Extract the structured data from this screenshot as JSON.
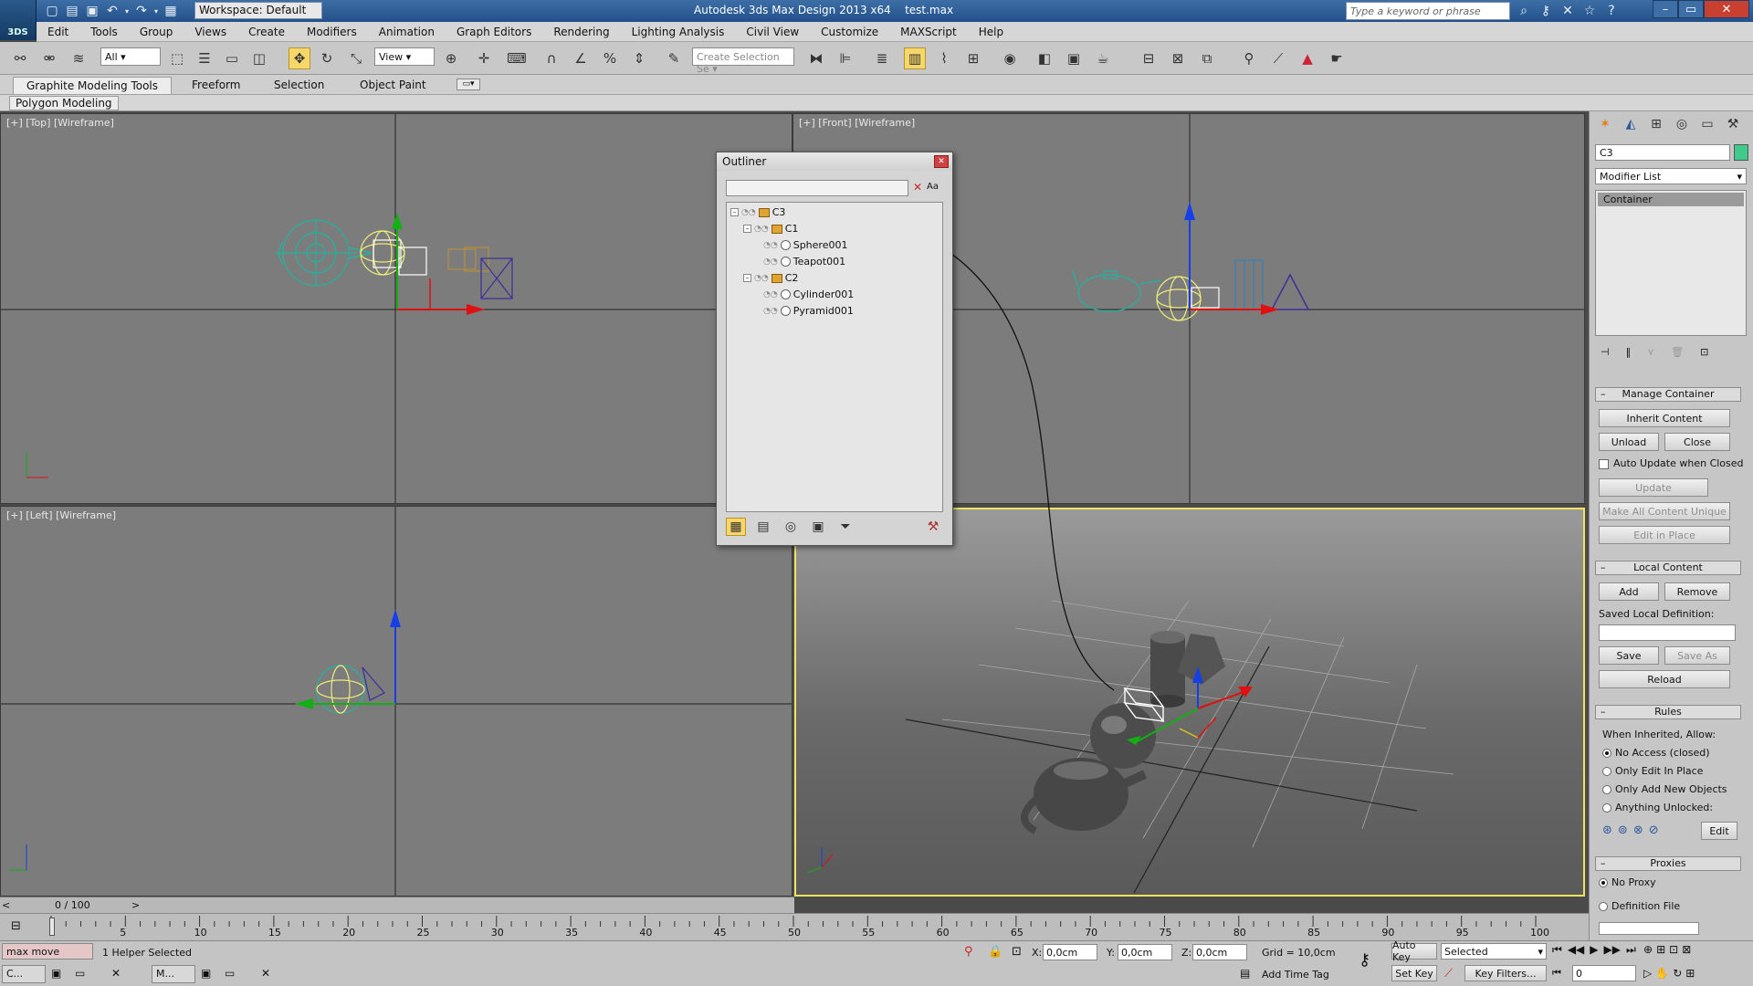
{
  "titlebar": {
    "workspace": "Workspace: Default",
    "app_title": "Autodesk 3ds Max Design 2013 x64",
    "file_name": "test.max",
    "search_placeholder": "Type a keyword or phrase",
    "logo_text": "3DS"
  },
  "menu": [
    "Edit",
    "Tools",
    "Group",
    "Views",
    "Create",
    "Modifiers",
    "Animation",
    "Graph Editors",
    "Rendering",
    "Lighting Analysis",
    "Civil View",
    "Customize",
    "MAXScript",
    "Help"
  ],
  "toolbar": {
    "filter_value": "All",
    "refcoord_value": "View",
    "selection_set_placeholder": "Create Selection Se"
  },
  "ribbon": {
    "tabs": [
      "Graphite Modeling Tools",
      "Freeform",
      "Selection",
      "Object Paint"
    ],
    "panel_label": "Polygon Modeling"
  },
  "viewports": {
    "top": "[+] [Top] [Wireframe]",
    "front": "[+] [Front] [Wireframe]",
    "left": "[+] [Left] [Wireframe]"
  },
  "outliner": {
    "title": "Outliner",
    "search_clear": "✕",
    "case_toggle": "Aa",
    "nodes": [
      {
        "label": "C3",
        "level": 0,
        "type": "container"
      },
      {
        "label": "C1",
        "level": 1,
        "type": "container"
      },
      {
        "label": "Sphere001",
        "level": 2,
        "type": "geo"
      },
      {
        "label": "Teapot001",
        "level": 2,
        "type": "geo"
      },
      {
        "label": "C2",
        "level": 1,
        "type": "container"
      },
      {
        "label": "Cylinder001",
        "level": 2,
        "type": "geo"
      },
      {
        "label": "Pyramid001",
        "level": 2,
        "type": "geo"
      }
    ]
  },
  "command_panel": {
    "object_name": "C3",
    "object_color": "#3fc98b",
    "modifier_list": "Modifier List",
    "stack_item": "Container",
    "manage_container": "Manage Container",
    "inherit_content": "Inherit Content",
    "unload": "Unload",
    "close": "Close",
    "auto_update": "Auto Update when Closed",
    "update": "Update",
    "make_all_unique": "Make All Content Unique",
    "edit_in_place": "Edit in Place",
    "local_content": "Local Content",
    "add": "Add",
    "remove": "Remove",
    "saved_local_def": "Saved Local Definition:",
    "save": "Save",
    "save_as": "Save As",
    "reload": "Reload",
    "rules": "Rules",
    "when_inherited": "When Inherited, Allow:",
    "rule_options": [
      "No Access (closed)",
      "Only Edit In Place",
      "Only Add New Objects",
      "Anything Unlocked:"
    ],
    "edit": "Edit",
    "proxies": "Proxies",
    "proxy_options": [
      "No Proxy",
      "Definition File"
    ]
  },
  "timeline": {
    "frame_counter": "0 / 100",
    "ticks": [
      "5",
      "10",
      "15",
      "20",
      "25",
      "30",
      "35",
      "40",
      "45",
      "50",
      "55",
      "60",
      "65",
      "70",
      "75",
      "80",
      "85",
      "90",
      "95",
      "100"
    ]
  },
  "status": {
    "script_text": "max move",
    "selection_info": "1 Helper Selected",
    "x_label": "X:",
    "x_value": "0,0cm",
    "y_label": "Y:",
    "y_value": "0,0cm",
    "z_label": "Z:",
    "z_value": "0,0cm",
    "grid": "Grid = 10,0cm",
    "auto_key": "Auto Key",
    "set_key": "Set Key",
    "key_mode": "Selected",
    "key_filters": "Key Filters...",
    "add_time_tag": "Add Time Tag",
    "frame_value": "0",
    "task_c": "C...",
    "task_m": "M..."
  },
  "colors": {
    "wire_teal": "#1fb5a0",
    "wire_yellow": "#ecec7a",
    "axis_red": "#e01010",
    "axis_green": "#12b012",
    "axis_blue": "#1640e6",
    "active_border": "#f2e45c"
  }
}
